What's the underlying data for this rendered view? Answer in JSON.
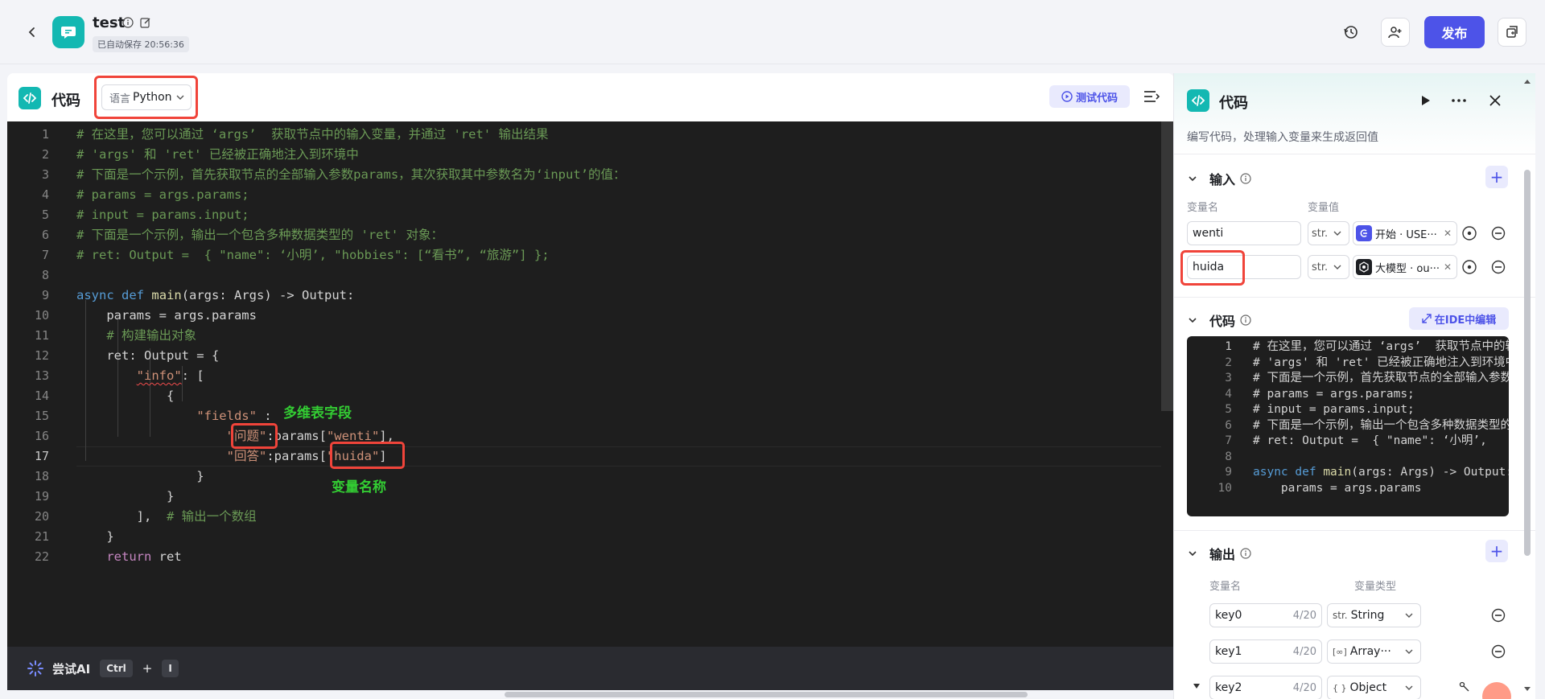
{
  "header": {
    "title": "test",
    "autosave": "已自动保存 20:56:36",
    "publish_label": "发布"
  },
  "editor": {
    "title": "代码",
    "language_prefix": "语言",
    "language_value": "Python",
    "test_button": "测试代码",
    "line_numbers": [
      "1",
      "2",
      "3",
      "4",
      "5",
      "6",
      "7",
      "8",
      "9",
      "10",
      "11",
      "12",
      "13",
      "14",
      "15",
      "16",
      "17",
      "18",
      "19",
      "20",
      "21",
      "22"
    ],
    "annotations": {
      "fields_note": "多维表字段",
      "var_note": "变量名称"
    },
    "ai_label": "尝试AI",
    "shortcut_ctrl": "Ctrl",
    "shortcut_plus": "+",
    "shortcut_key": "I"
  },
  "side": {
    "title": "代码",
    "description": "编写代码，处理输入变量来生成返回值",
    "input_section": "输入",
    "col_var_name": "变量名",
    "col_var_value": "变量值",
    "inputs": [
      {
        "name": "wenti",
        "type": "str.",
        "ref": "开始 · USE···",
        "ref_color": "#4d53e8"
      },
      {
        "name": "huida",
        "type": "str.",
        "ref": "大模型 · ou···",
        "ref_color": "#1d1f23"
      }
    ],
    "code_section": "代码",
    "ide_button": "在IDE中编辑",
    "output_section": "输出",
    "col_out_name": "变量名",
    "col_out_type": "变量类型",
    "outputs": [
      {
        "name": "key0",
        "count": "4/20",
        "type_icon": "str.",
        "type": "String"
      },
      {
        "name": "key1",
        "count": "4/20",
        "type_icon": "[∞]",
        "type": "Array···"
      },
      {
        "name": "key2",
        "count": "4/20",
        "type_icon": "{ }",
        "type": "Object"
      }
    ]
  },
  "colors": {
    "accent": "#4d53e8",
    "teal": "#13b8b2",
    "highlight_red": "#f0443a",
    "annotation_green": "#33cc33"
  }
}
